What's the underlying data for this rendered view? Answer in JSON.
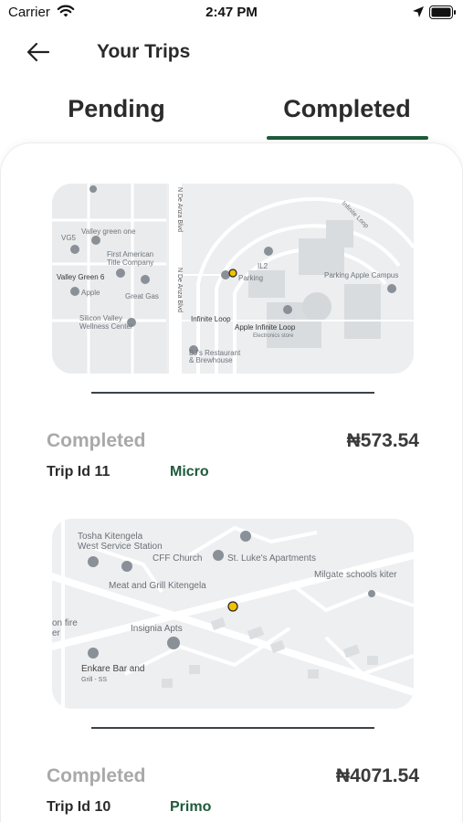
{
  "status_bar": {
    "carrier": "Carrier",
    "time": "2:47 PM",
    "icons": [
      "wifi-icon",
      "location-arrow-icon",
      "battery-icon"
    ]
  },
  "header": {
    "title": "Your Trips",
    "back_icon": "back-arrow-icon"
  },
  "tabs": [
    {
      "label": "Pending",
      "active": false
    },
    {
      "label": "Completed",
      "active": true
    }
  ],
  "colors": {
    "accent": "#1f5a3b",
    "status_text": "#a9a9a9",
    "map_bg": "#eef0f2"
  },
  "trips": [
    {
      "status": "Completed",
      "price": "₦573.54",
      "trip_id": "Trip Id 11",
      "ride_type": "Micro",
      "map": {
        "labels": {
          "valley_green": "Valley green one",
          "vg5": "VG5",
          "first_american": "First American",
          "title_company": "Title Company",
          "valley_green_6": "Valley Green 6",
          "apple": "Apple",
          "great_gas": "Great Gas",
          "silicon_valley": "Silicon Valley",
          "wellness_center": "Wellness Center",
          "de_anza_1": "N De Anza Blvd",
          "de_anza_2": "N De Anza Blvd",
          "infinite_loop_1": "Infinite Loop",
          "infinite_loop_2": "Infinite Loop",
          "bjs": "BJ's Restaurant",
          "brewhouse": "& Brewhouse",
          "apple_infinite": "Apple Infinite Loop",
          "electronics": "Electronics store",
          "il2": "IL2",
          "parking": "Parking",
          "parking_campus": "Parking Apple Campus"
        }
      }
    },
    {
      "status": "Completed",
      "price": "₦4071.54",
      "trip_id": "Trip Id 10",
      "ride_type": "Primo",
      "map": {
        "labels": {
          "tosha": "Tosha Kitengela",
          "west_service": "West Service Station",
          "cff": "CFF Church",
          "st_lukes": "St. Luke's Apartments",
          "milgate": "Milgate schools kiter",
          "meat_grill": "Meat and Grill Kitengela",
          "on_fire": "on fire",
          "er": "er",
          "insignia": "Insignia Apts",
          "enkare": "Enkare Bar and",
          "grill_ss": "Grill - SS"
        }
      }
    }
  ]
}
